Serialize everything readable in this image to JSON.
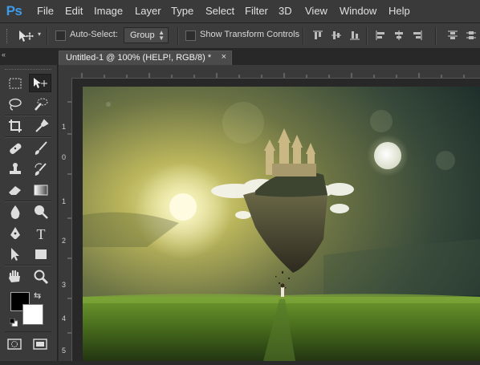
{
  "app": {
    "logo": "Ps"
  },
  "menu": [
    "File",
    "Edit",
    "Image",
    "Layer",
    "Type",
    "Select",
    "Filter",
    "3D",
    "View",
    "Window",
    "Help"
  ],
  "options": {
    "tool_icon": "move-tool-icon",
    "auto_select_label": "Auto-Select:",
    "auto_select_checked": false,
    "auto_select_value": "Group",
    "show_transform_label": "Show Transform Controls",
    "show_transform_checked": false
  },
  "document": {
    "tab_title": "Untitled-1 @ 100% (HELP!, RGB/8) *",
    "close_glyph": "×"
  },
  "panel": {
    "collapse_glyph": "«"
  },
  "ruler": {
    "left_marks": [
      "1",
      "0",
      "1",
      "2",
      "3",
      "4",
      "5"
    ]
  },
  "colors": {
    "foreground": "#000000",
    "background": "#ffffff",
    "accent": "#3d9be9"
  },
  "toolbox": {
    "tools": [
      "rectangular-marquee",
      "move",
      "lasso",
      "quick-selection",
      "crop",
      "eyedropper",
      "spot-healing",
      "brush",
      "clone-stamp",
      "history-brush",
      "eraser",
      "gradient",
      "blur",
      "dodge",
      "pen",
      "type",
      "path-selection",
      "rectangle",
      "hand",
      "zoom"
    ],
    "active_tool": "move"
  }
}
